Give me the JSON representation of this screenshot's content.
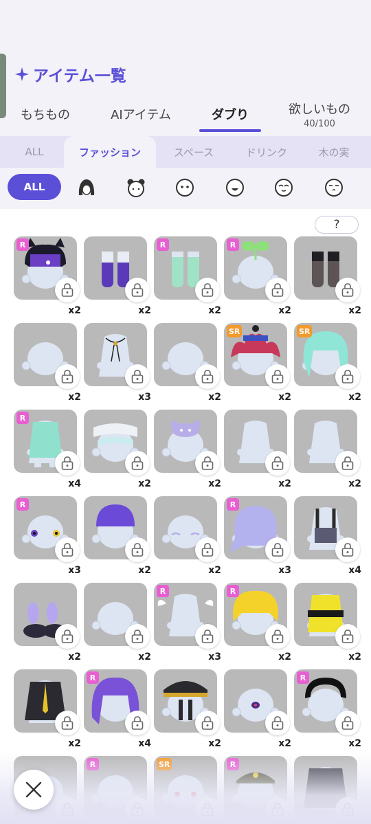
{
  "header": {
    "title": "アイテム一覧"
  },
  "main_tabs": [
    {
      "label": "もちもの",
      "sub": ""
    },
    {
      "label": "AIアイテム",
      "sub": ""
    },
    {
      "label": "ダブり",
      "sub": "",
      "active": true
    },
    {
      "label": "欲しいもの",
      "sub": "40/100"
    }
  ],
  "category_tabs": [
    {
      "label": "ALL"
    },
    {
      "label": "ファッション",
      "active": true
    },
    {
      "label": "スペース"
    },
    {
      "label": "ドリンク"
    },
    {
      "label": "木の実"
    }
  ],
  "filters": {
    "all_label": "ALL",
    "icons": [
      "hair-icon",
      "head-ears-icon",
      "face-eyes-icon",
      "face-mouth-icon",
      "face-happy-icon",
      "face-sleepy-icon"
    ]
  },
  "help": {
    "label": "?"
  },
  "items": [
    {
      "rarity": "R",
      "qty": "x2",
      "kind": "hood"
    },
    {
      "rarity": "",
      "qty": "x2",
      "kind": "boots-purple"
    },
    {
      "rarity": "R",
      "qty": "x2",
      "kind": "socks-mint"
    },
    {
      "rarity": "R",
      "qty": "x2",
      "kind": "sprout"
    },
    {
      "rarity": "",
      "qty": "x2",
      "kind": "boots-dark"
    },
    {
      "rarity": "",
      "qty": "x2",
      "kind": "head-plain"
    },
    {
      "rarity": "",
      "qty": "x3",
      "kind": "bolo-tie"
    },
    {
      "rarity": "",
      "qty": "x2",
      "kind": "head-plain"
    },
    {
      "rarity": "SR",
      "qty": "x2",
      "kind": "flame-hat"
    },
    {
      "rarity": "SR",
      "qty": "x2",
      "kind": "mint-hair"
    },
    {
      "rarity": "R",
      "qty": "x4",
      "kind": "coat-mint"
    },
    {
      "rarity": "",
      "qty": "x2",
      "kind": "bandage"
    },
    {
      "rarity": "",
      "qty": "x2",
      "kind": "lilac-plush"
    },
    {
      "rarity": "",
      "qty": "x2",
      "kind": "body-plain"
    },
    {
      "rarity": "",
      "qty": "x2",
      "kind": "body-plain"
    },
    {
      "rarity": "R",
      "qty": "x3",
      "kind": "odd-eyes"
    },
    {
      "rarity": "",
      "qty": "x2",
      "kind": "purple-cap"
    },
    {
      "rarity": "",
      "qty": "x2",
      "kind": "sleepy"
    },
    {
      "rarity": "R",
      "qty": "x3",
      "kind": "lilac-hair"
    },
    {
      "rarity": "",
      "qty": "x4",
      "kind": "suspenders"
    },
    {
      "rarity": "",
      "qty": "x2",
      "kind": "bunny-slippers"
    },
    {
      "rarity": "",
      "qty": "x2",
      "kind": "head-plain"
    },
    {
      "rarity": "R",
      "qty": "x3",
      "kind": "wings"
    },
    {
      "rarity": "R",
      "qty": "x2",
      "kind": "yellow-hair"
    },
    {
      "rarity": "",
      "qty": "x2",
      "kind": "yellow-jacket"
    },
    {
      "rarity": "",
      "qty": "x2",
      "kind": "black-jacket"
    },
    {
      "rarity": "R",
      "qty": "x4",
      "kind": "purple-hair"
    },
    {
      "rarity": "",
      "qty": "x2",
      "kind": "officer-hat"
    },
    {
      "rarity": "",
      "qty": "x2",
      "kind": "one-eye"
    },
    {
      "rarity": "R",
      "qty": "x2",
      "kind": "black-headband"
    },
    {
      "rarity": "",
      "qty": "",
      "kind": "head-plain"
    },
    {
      "rarity": "R",
      "qty": "",
      "kind": "head-plain"
    },
    {
      "rarity": "SR",
      "qty": "",
      "kind": "red-eyes"
    },
    {
      "rarity": "R",
      "qty": "",
      "kind": "army-cap"
    },
    {
      "rarity": "",
      "qty": "",
      "kind": "black-hoodie"
    }
  ],
  "colors": {
    "accent": "#5b4fd8",
    "badge_r": "#e85fd2",
    "badge_sr": "#f39a2c",
    "tile_bg": "#b9b9b9"
  }
}
